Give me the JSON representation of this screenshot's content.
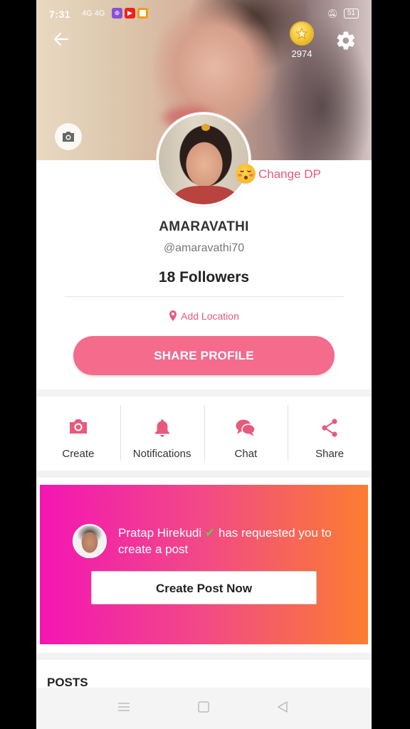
{
  "status_bar": {
    "time": "7:31",
    "signal": "4G 4G",
    "battery": "51"
  },
  "header": {
    "coins": "2974"
  },
  "profile": {
    "change_dp_label": "Change DP",
    "name": "AMARAVATHI",
    "handle": "@amaravathi70",
    "followers": "18 Followers",
    "add_location_label": "Add Location",
    "share_button_label": "SHARE PROFILE"
  },
  "actions": [
    {
      "label": "Create",
      "icon": "camera-icon"
    },
    {
      "label": "Notifications",
      "icon": "bell-icon"
    },
    {
      "label": "Chat",
      "icon": "chat-icon"
    },
    {
      "label": "Share",
      "icon": "share-icon"
    }
  ],
  "request_card": {
    "requester": "Pratap Hirekudi",
    "verified_mark": "✔",
    "message": "has requested you to create a post",
    "button_label": "Create Post Now"
  },
  "posts": {
    "title": "POSTS"
  },
  "colors": {
    "accent": "#f46b8c",
    "accent_text": "#e75a7c",
    "banner_start": "#f316b3",
    "banner_end": "#fb7d30"
  }
}
